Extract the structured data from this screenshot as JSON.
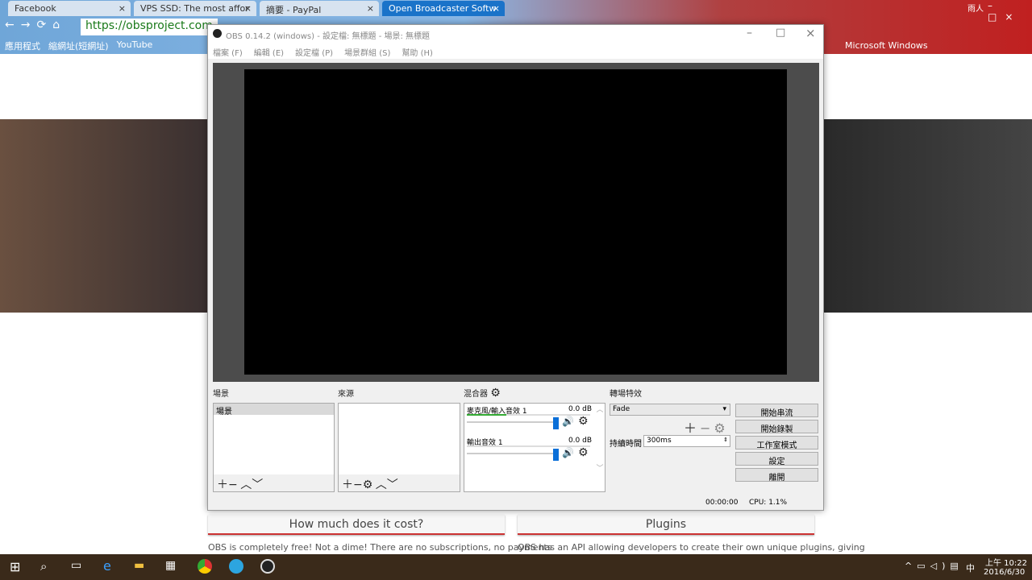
{
  "browser": {
    "tabs": [
      {
        "label": "Facebook"
      },
      {
        "label": "VPS SSD: The most affor"
      },
      {
        "label": "摘要 - PayPal"
      },
      {
        "label": "Open Broadcaster Softw"
      }
    ],
    "url": "https://obsproject.com",
    "profile": "雨人",
    "bookmarks": [
      "應用程式",
      "縮網址(短網址)",
      "YouTube",
      "Microsoft Windows"
    ]
  },
  "page": {
    "cost_button": "How much does it cost?",
    "plugins_button": "Plugins",
    "cost_text": "OBS is completely free! Not a dime! There are no subscriptions, no payments",
    "plugins_text": "OBS has an API allowing developers to create their own unique plugins, giving"
  },
  "obs": {
    "title": "OBS 0.14.2 (windows) - 設定檔: 無標題 - 場景: 無標題",
    "menu": [
      "檔案 (F)",
      "編輯 (E)",
      "設定檔 (P)",
      "場景群組 (S)",
      "幫助 (H)"
    ],
    "scenes_label": "場景",
    "scenes": [
      "場景"
    ],
    "sources_label": "來源",
    "mixer_label": "混合器",
    "mixer": [
      {
        "name": "麥克風/輸入音效 1",
        "db": "0.0 dB",
        "level": 0.32
      },
      {
        "name": "輸出音效 1",
        "db": "0.0 dB",
        "level": 0.0
      }
    ],
    "transition_label": "轉場特效",
    "transition": "Fade",
    "duration_label": "持續時間",
    "duration": "300ms",
    "buttons": [
      "開始串流",
      "開始錄製",
      "工作室模式",
      "設定",
      "離開"
    ],
    "status_time": "00:00:00",
    "status_cpu": "CPU: 1.1%"
  },
  "taskbar": {
    "time": "上午 10:22",
    "date": "2016/6/30",
    "ime": "中"
  }
}
